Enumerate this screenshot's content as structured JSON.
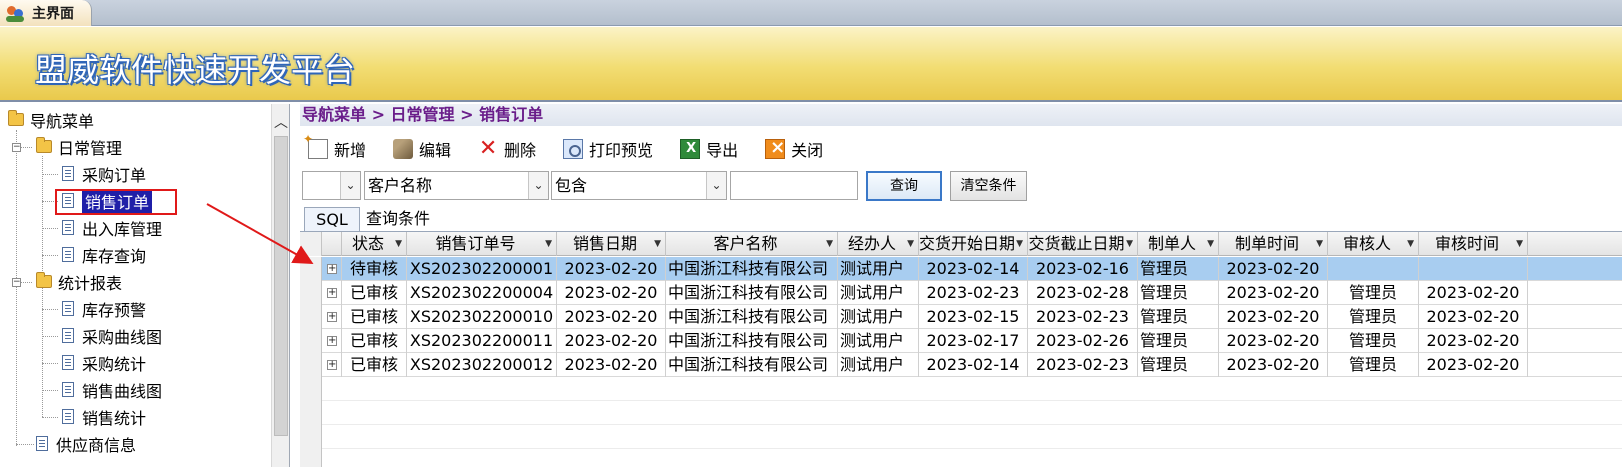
{
  "window": {
    "tab_label": "主界面"
  },
  "banner": {
    "title": "盟威软件快速开发平台"
  },
  "sidebar": {
    "root": "导航菜单",
    "groups": [
      {
        "label": "日常管理",
        "items": [
          "采购订单",
          "销售订单",
          "出入库管理",
          "库存查询"
        ]
      },
      {
        "label": "统计报表",
        "items": [
          "库存预警",
          "采购曲线图",
          "采购统计",
          "销售曲线图",
          "销售统计"
        ]
      }
    ],
    "trailing_item": "供应商信息",
    "selected_item": "销售订单"
  },
  "breadcrumb": "导航菜单 > 日常管理 > 销售订单",
  "toolbar": {
    "new": "新增",
    "edit": "编辑",
    "delete": "删除",
    "print_preview": "打印预览",
    "export": "导出",
    "close": "关闭"
  },
  "filter": {
    "field": "客户名称",
    "operator": "包含",
    "value": "",
    "query_button": "查询",
    "clear_button": "清空条件"
  },
  "subtabs": {
    "sql": "SQL",
    "conditions": "查询条件"
  },
  "grid": {
    "columns": [
      "状态",
      "销售订单号",
      "销售日期",
      "客户名称",
      "经办人",
      "交货开始日期",
      "交货截止日期",
      "制单人",
      "制单时间",
      "审核人",
      "审核时间"
    ],
    "rows": [
      [
        "待审核",
        "XS202302200001",
        "2023-02-20",
        "中国浙江科技有限公司",
        "测试用户",
        "2023-02-14",
        "2023-02-16",
        "管理员",
        "2023-02-20",
        "",
        ""
      ],
      [
        "已审核",
        "XS202302200004",
        "2023-02-20",
        "中国浙江科技有限公司",
        "测试用户",
        "2023-02-23",
        "2023-02-28",
        "管理员",
        "2023-02-20",
        "管理员",
        "2023-02-20"
      ],
      [
        "已审核",
        "XS202302200010",
        "2023-02-20",
        "中国浙江科技有限公司",
        "测试用户",
        "2023-02-15",
        "2023-02-23",
        "管理员",
        "2023-02-20",
        "管理员",
        "2023-02-20"
      ],
      [
        "已审核",
        "XS202302200011",
        "2023-02-20",
        "中国浙江科技有限公司",
        "测试用户",
        "2023-02-17",
        "2023-02-26",
        "管理员",
        "2023-02-20",
        "管理员",
        "2023-02-20"
      ],
      [
        "已审核",
        "XS202302200012",
        "2023-02-20",
        "中国浙江科技有限公司",
        "测试用户",
        "2023-02-14",
        "2023-02-23",
        "管理员",
        "2023-02-20",
        "管理员",
        "2023-02-20"
      ]
    ],
    "selected_row": 0
  },
  "colors": {
    "selected_row": "#a8cdf0",
    "tree_selected": "#1f1fa8",
    "annotation": "#e01919",
    "breadcrumb": "#6a1d8a"
  }
}
